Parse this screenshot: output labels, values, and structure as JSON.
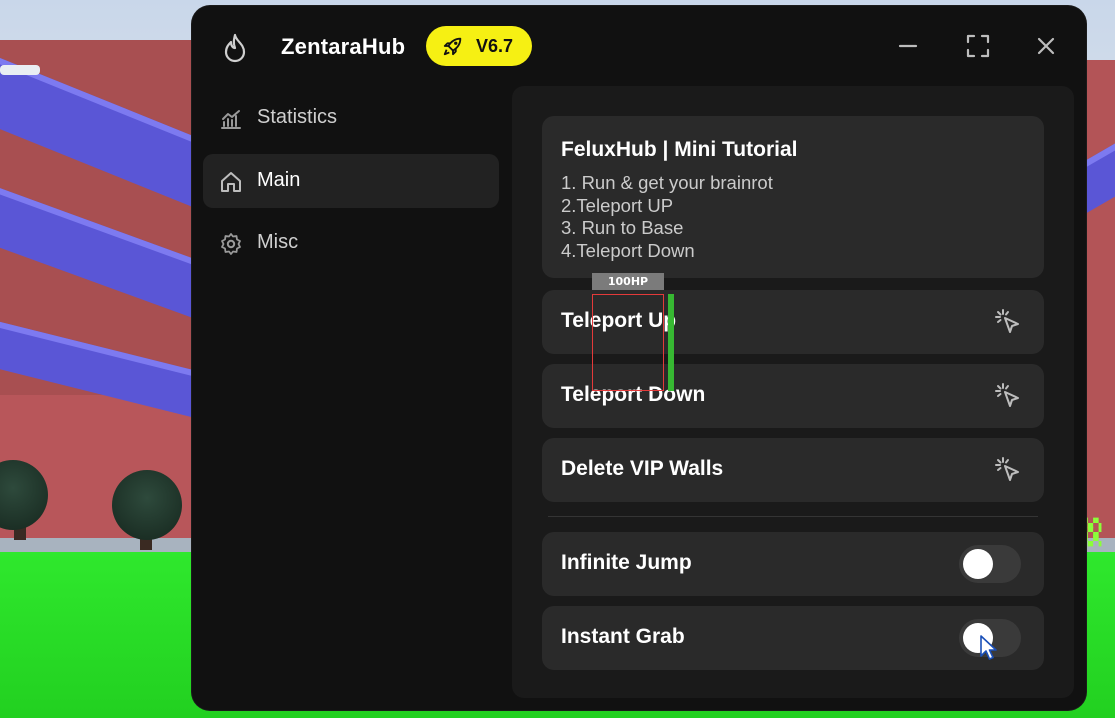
{
  "app": {
    "title": "ZentaraHub",
    "version": "V6.7",
    "accent_color": "#f6f013"
  },
  "window_controls": {
    "minimize": "minimize-icon",
    "maximize": "maximize-icon",
    "close": "close-icon"
  },
  "sidebar": {
    "items": [
      {
        "label": "Statistics",
        "icon": "chart-icon",
        "active": false
      },
      {
        "label": "Main",
        "icon": "home-icon",
        "active": true
      },
      {
        "label": "Misc",
        "icon": "gear-icon",
        "active": false
      }
    ]
  },
  "tutorial": {
    "title": "FeluxHub | Mini Tutorial",
    "lines": [
      "1. Run & get your brainrot",
      "2.Teleport UP",
      "3. Run to Base",
      "4.Teleport Down"
    ]
  },
  "actions": [
    {
      "label": "Teleport Up",
      "icon": "click-cursor-icon"
    },
    {
      "label": "Teleport Down",
      "icon": "click-cursor-icon"
    },
    {
      "label": "Delete VIP Walls",
      "icon": "click-cursor-icon"
    }
  ],
  "toggles": [
    {
      "label": "Infinite Jump",
      "enabled": false
    },
    {
      "label": "Instant Grab",
      "enabled": false
    }
  ],
  "esp": {
    "hp_label": "100HP",
    "box_color": "#e43a3a",
    "health_color": "#37b832"
  }
}
